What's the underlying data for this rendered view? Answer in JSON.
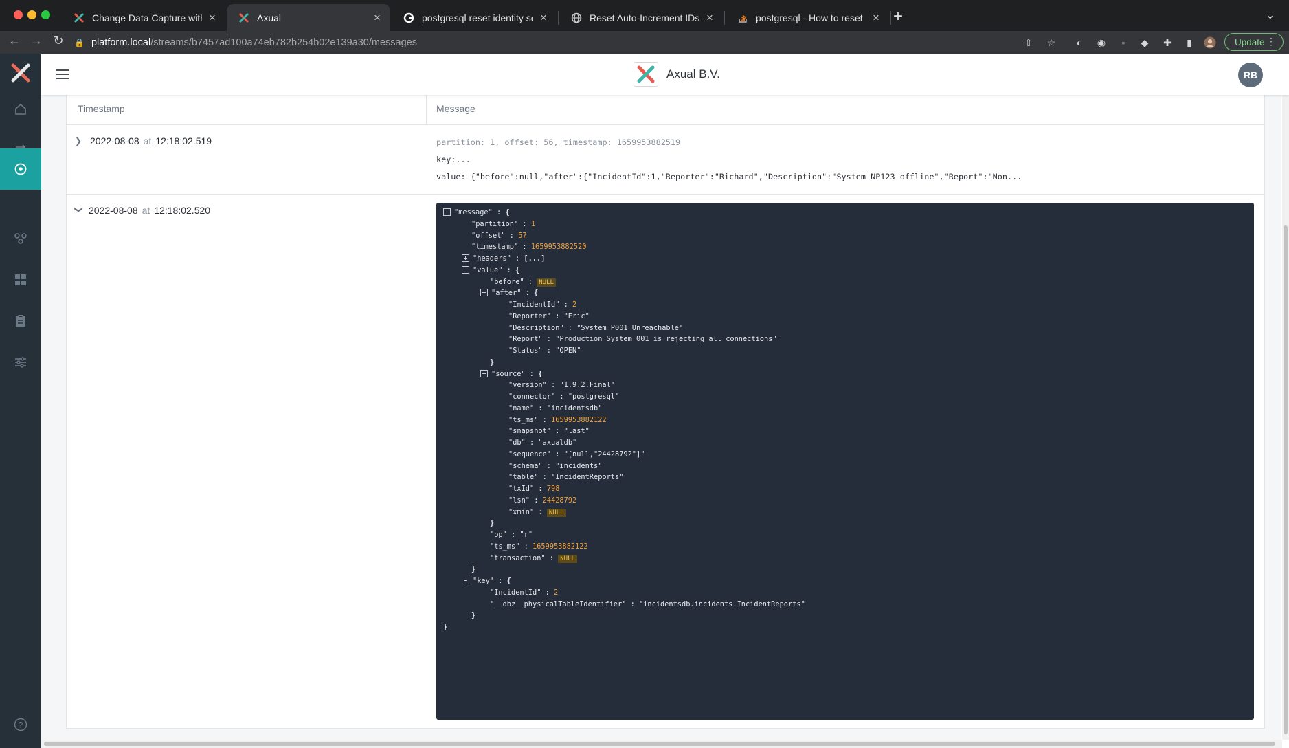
{
  "browser": {
    "tabs": [
      {
        "title": "Change Data Capture with Pos",
        "icon": "axual-logo-icon"
      },
      {
        "title": "Axual",
        "icon": "axual-logo-icon"
      },
      {
        "title": "postgresql reset identity seque",
        "icon": "google-icon"
      },
      {
        "title": "Reset Auto-Increment IDs in Po",
        "icon": "globe-icon"
      },
      {
        "title": "postgresql - How to reset sequ",
        "icon": "stackoverflow-icon"
      }
    ],
    "url_host": "platform.local",
    "url_path": "/streams/b7457ad100a74eb782b254b02e139a30/messages",
    "update_label": "Update"
  },
  "header": {
    "brand_name": "Axual B.V.",
    "avatar_initials": "RB"
  },
  "table": {
    "col_timestamp": "Timestamp",
    "col_message": "Message"
  },
  "rows": [
    {
      "date": "2022-08-08",
      "at": "at",
      "time": "12:18:02.519",
      "meta": "partition: 1, offset: 56, timestamp: 1659953882519",
      "key": "key:...",
      "value": "value: {\"before\":null,\"after\":{\"IncidentId\":1,\"Reporter\":\"Richard\",\"Description\":\"System NP123 offline\",\"Report\":\"Non..."
    },
    {
      "date": "2022-08-08",
      "at": "at",
      "time": "12:18:02.520"
    }
  ],
  "json_lines": [
    {
      "toggle": "minus",
      "key": "\"message\"",
      "sep": " : ",
      "val": "{",
      "vtype": "brace"
    },
    {
      "key": "\"partition\"",
      "sep": " : ",
      "val": "1",
      "vtype": "num"
    },
    {
      "key": "\"offset\"",
      "sep": " : ",
      "val": "57",
      "vtype": "num"
    },
    {
      "key": "\"timestamp\"",
      "sep": " : ",
      "val": "1659953882520",
      "vtype": "num"
    },
    {
      "toggle": "plus",
      "key": "\"headers\"",
      "sep": " : ",
      "val": "[...]",
      "vtype": "brace"
    },
    {
      "toggle": "minus",
      "key": "\"value\"",
      "sep": " : ",
      "val": "{",
      "vtype": "brace"
    },
    {
      "key": "\"before\"",
      "sep": " : ",
      "val": "NULL",
      "vtype": "null"
    },
    {
      "toggle": "minus",
      "key": "\"after\"",
      "sep": " : ",
      "val": "{",
      "vtype": "brace"
    },
    {
      "key": "\"IncidentId\"",
      "sep": " : ",
      "val": "2",
      "vtype": "num"
    },
    {
      "key": "\"Reporter\"",
      "sep": " : ",
      "val": "\"Eric\"",
      "vtype": "str"
    },
    {
      "key": "\"Description\"",
      "sep": " : ",
      "val": "\"System P001 Unreachable\"",
      "vtype": "str"
    },
    {
      "key": "\"Report\"",
      "sep": " : ",
      "val": "\"Production System 001 is rejecting all connections\"",
      "vtype": "str"
    },
    {
      "key": "\"Status\"",
      "sep": " : ",
      "val": "\"OPEN\"",
      "vtype": "str"
    },
    {
      "key": "",
      "sep": "",
      "val": "}",
      "vtype": "brace"
    },
    {
      "toggle": "minus",
      "key": "\"source\"",
      "sep": " : ",
      "val": "{",
      "vtype": "brace"
    },
    {
      "key": "\"version\"",
      "sep": " : ",
      "val": "\"1.9.2.Final\"",
      "vtype": "str"
    },
    {
      "key": "\"connector\"",
      "sep": " : ",
      "val": "\"postgresql\"",
      "vtype": "str"
    },
    {
      "key": "\"name\"",
      "sep": " : ",
      "val": "\"incidentsdb\"",
      "vtype": "str"
    },
    {
      "key": "\"ts_ms\"",
      "sep": " : ",
      "val": "1659953882122",
      "vtype": "num"
    },
    {
      "key": "\"snapshot\"",
      "sep": " : ",
      "val": "\"last\"",
      "vtype": "str"
    },
    {
      "key": "\"db\"",
      "sep": " : ",
      "val": "\"axualdb\"",
      "vtype": "str"
    },
    {
      "key": "\"sequence\"",
      "sep": " : ",
      "val": "\"[null,\"24428792\"]\"",
      "vtype": "str"
    },
    {
      "key": "\"schema\"",
      "sep": " : ",
      "val": "\"incidents\"",
      "vtype": "str"
    },
    {
      "key": "\"table\"",
      "sep": " : ",
      "val": "\"IncidentReports\"",
      "vtype": "str"
    },
    {
      "key": "\"txId\"",
      "sep": " : ",
      "val": "798",
      "vtype": "num"
    },
    {
      "key": "\"lsn\"",
      "sep": " : ",
      "val": "24428792",
      "vtype": "num"
    },
    {
      "key": "\"xmin\"",
      "sep": " : ",
      "val": "NULL",
      "vtype": "null"
    },
    {
      "key": "",
      "sep": "",
      "val": "}",
      "vtype": "brace"
    },
    {
      "key": "\"op\"",
      "sep": " : ",
      "val": "\"r\"",
      "vtype": "str"
    },
    {
      "key": "\"ts_ms\"",
      "sep": " : ",
      "val": "1659953882122",
      "vtype": "num"
    },
    {
      "key": "\"transaction\"",
      "sep": " : ",
      "val": "NULL",
      "vtype": "null"
    },
    {
      "key": "",
      "sep": "",
      "val": "}",
      "vtype": "brace"
    },
    {
      "toggle": "minus",
      "key": "\"key\"",
      "sep": " : ",
      "val": "{",
      "vtype": "brace"
    },
    {
      "key": "\"IncidentId\"",
      "sep": " : ",
      "val": "2",
      "vtype": "num"
    },
    {
      "key": "\"__dbz__physicalTableIdentifier\"",
      "sep": " : ",
      "val": "\"incidentsdb.incidents.IncidentReports\"",
      "vtype": "str"
    },
    {
      "key": "",
      "sep": "",
      "val": "}",
      "vtype": "brace"
    },
    {
      "key": "",
      "sep": "",
      "val": "}",
      "vtype": "brace"
    }
  ],
  "colors": {
    "accent": "#1aa1a0",
    "sidebar": "#253039",
    "json_bg": "#262d3a",
    "number": "#f0a23b",
    "null_badge": "#f2c14e"
  }
}
